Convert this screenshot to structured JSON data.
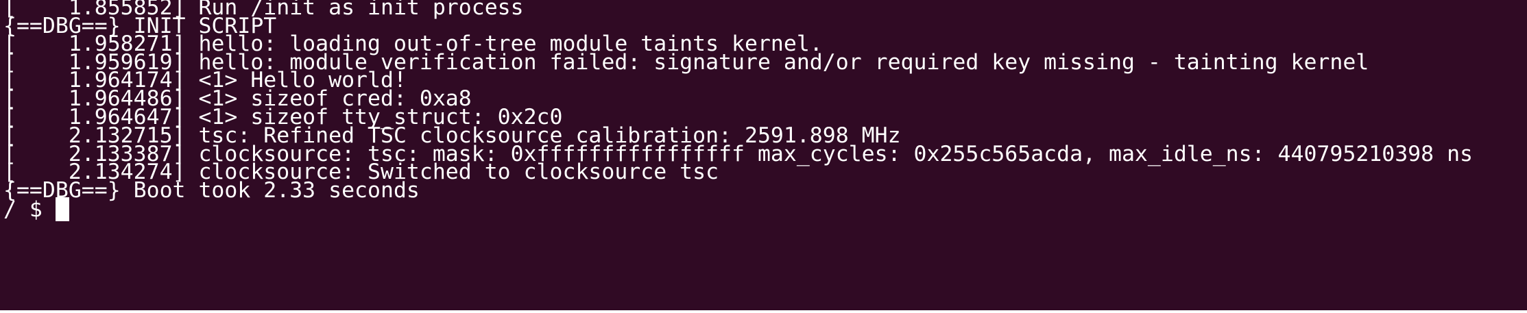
{
  "terminal": {
    "background": "#300a24",
    "foreground": "#ffffff",
    "lines": [
      "[    1.855852] Run /init as init process",
      "{==DBG==} INIT SCRIPT",
      "[    1.958271] hello: loading out-of-tree module taints kernel.",
      "[    1.959619] hello: module verification failed: signature and/or required key missing - tainting kernel",
      "[    1.964174] <1> Hello world!",
      "[    1.964486] <1> sizeof cred: 0xa8",
      "[    1.964647] <1> sizeof tty_struct: 0x2c0",
      "[    2.132715] tsc: Refined TSC clocksource calibration: 2591.898 MHz",
      "[    2.133387] clocksource: tsc: mask: 0xffffffffffffffff max_cycles: 0x255c565acda, max_idle_ns: 440795210398 ns",
      "[    2.134274] clocksource: Switched to clocksource tsc",
      "{==DBG==} Boot took 2.33 seconds"
    ],
    "prompt": "/ $ "
  }
}
